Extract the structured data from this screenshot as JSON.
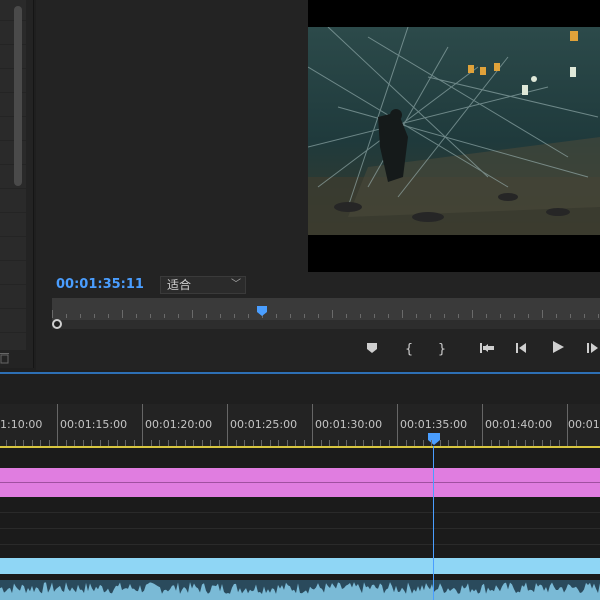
{
  "monitor": {
    "timecode": "00:01:35:11",
    "fit_select_value": "适合"
  },
  "timeline": {
    "ruler_labels": [
      "1:10:00",
      "00:01:15:00",
      "00:01:20:00",
      "00:01:25:00",
      "00:01:30:00",
      "00:01:35:00",
      "00:01:40:00",
      "00:01:"
    ]
  },
  "icons": {
    "add_marker": "add-marker-icon",
    "mark_in": "mark-in-icon",
    "mark_out": "mark-out-icon",
    "go_to_in": "go-to-in-icon",
    "step_back": "step-back-icon",
    "play": "play-icon",
    "step_forward": "step-forward-icon",
    "trash": "trash-icon"
  },
  "colors": {
    "accent": "#4a9eff",
    "work_area": "#d8c640",
    "video_clip": "#e07de0",
    "audio_clip": "#8fd6f5"
  }
}
